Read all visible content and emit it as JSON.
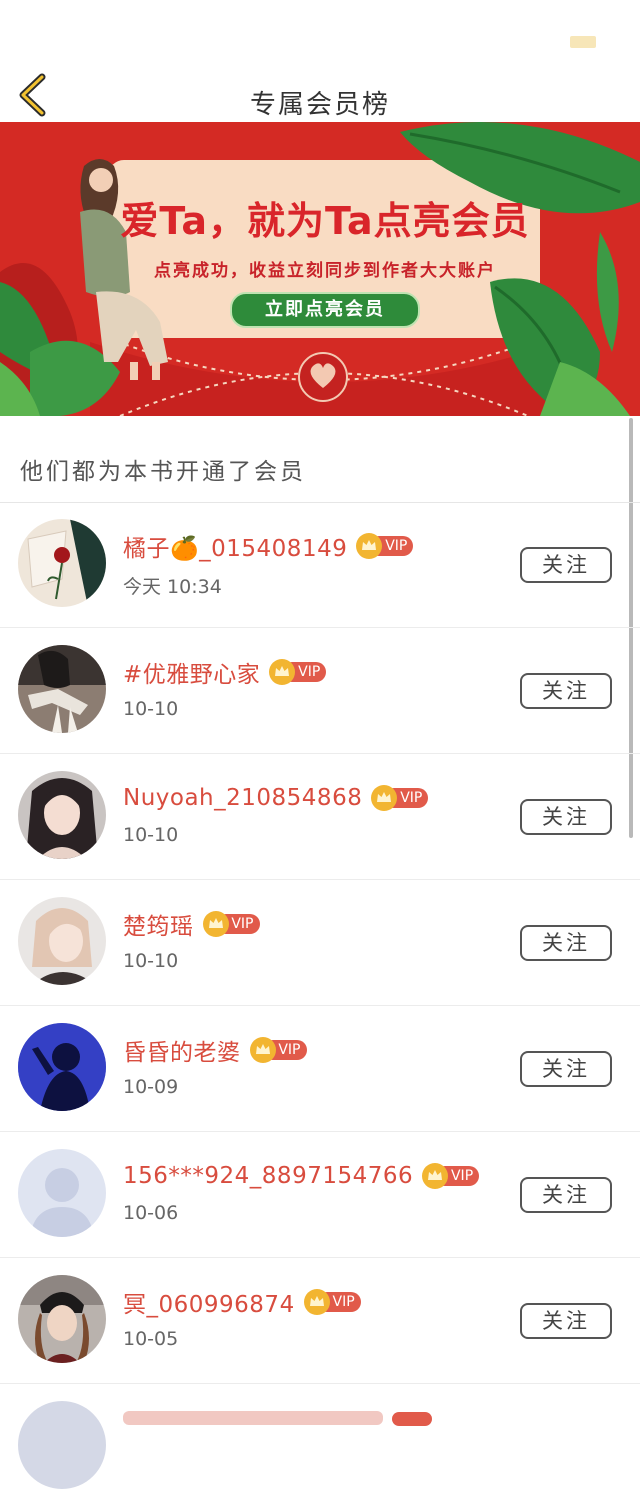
{
  "nav": {
    "title": "专属会员榜"
  },
  "banner": {
    "headline": "爱Ta，就为Ta点亮会员",
    "subtitle": "点亮成功，收益立刻同步到作者大大账户",
    "cta": "立即点亮会员"
  },
  "section": {
    "title": "他们都为本书开通了会员"
  },
  "vip_label": "VIP",
  "follow_label": "关注",
  "members": [
    {
      "name": "橘子🍊_015408149",
      "time": "今天 10:34"
    },
    {
      "name": "#优雅野心家",
      "time": "10-10"
    },
    {
      "name": "Nuyoah_210854868",
      "time": "10-10"
    },
    {
      "name": "楚筠瑶",
      "time": "10-10"
    },
    {
      "name": "昏昏的老婆",
      "time": "10-09"
    },
    {
      "name": "156***924_8897154766",
      "time": "10-06"
    },
    {
      "name": "冥_060996874",
      "time": "10-05"
    }
  ],
  "colors": {
    "banner_red": "#d42a24",
    "name_red": "#d84c3e",
    "vip_pill": "#e15a4a",
    "crown_gold": "#f2b531",
    "cta_green": "#2e8b3a"
  }
}
